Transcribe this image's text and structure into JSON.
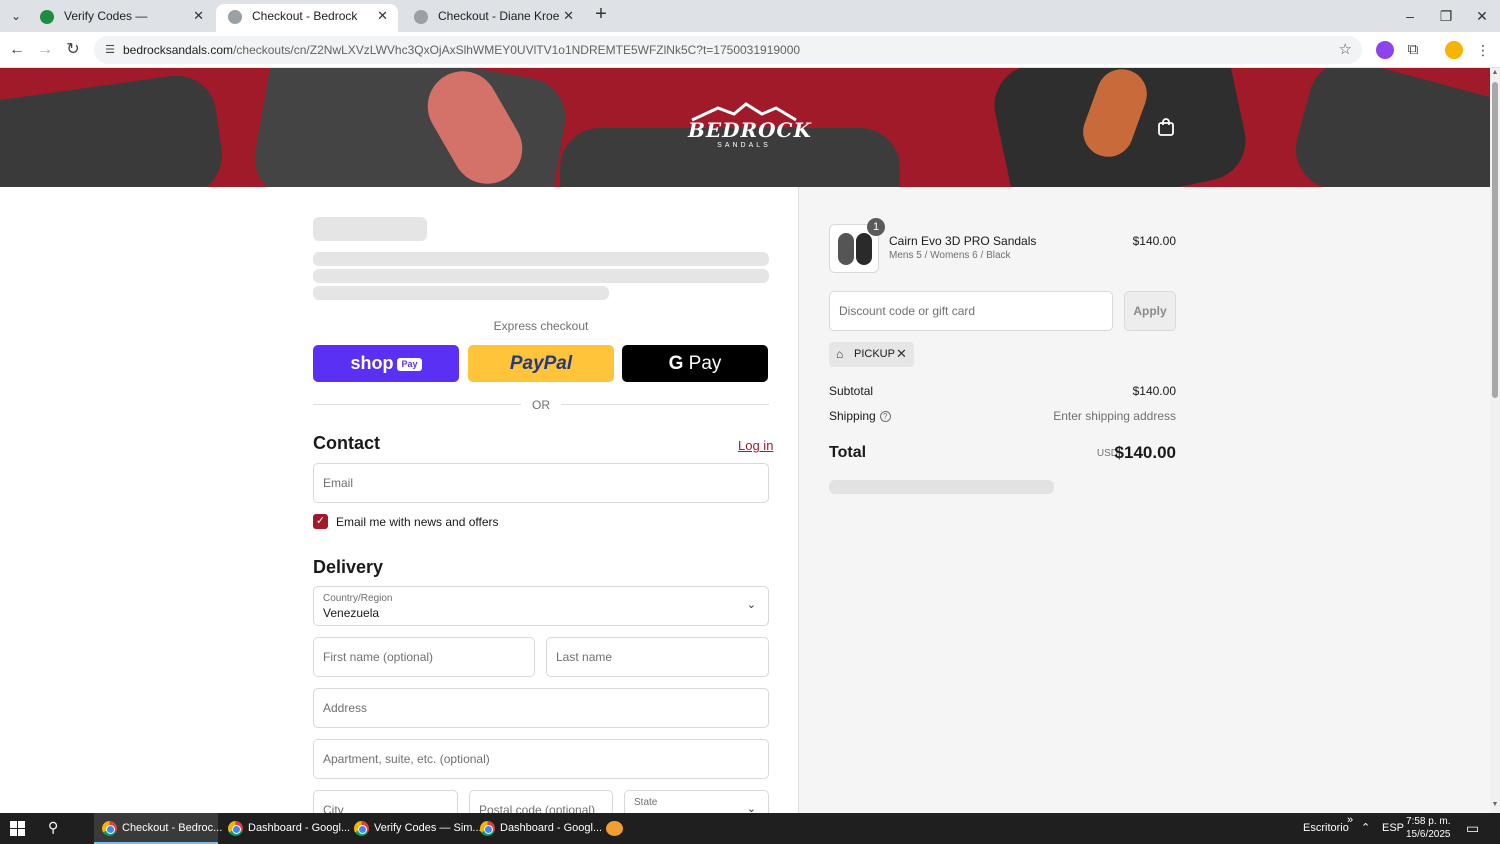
{
  "browser": {
    "tabs": [
      {
        "title": "Verify Codes — SimplyCodes",
        "active": false
      },
      {
        "title": "Checkout - Bedrock Sandals",
        "active": true
      },
      {
        "title": "Checkout - Diane Kroe",
        "active": false
      }
    ],
    "url_host": "bedrocksandals.com",
    "url_path": "/checkouts/cn/Z2NwLXVzLWVhc3QxOjAxSlhWMEY0UVlTV1o1NDREMTE5WFZlNk5C?t=1750031919000"
  },
  "header": {
    "logo_text": "BEDROCK",
    "logo_sub": "SANDALS"
  },
  "checkout": {
    "express_label": "Express checkout",
    "shop_pay_label": "shop",
    "shop_pay_tag": "Pay",
    "paypal_label": "PayPal",
    "gpay_label": "Pay",
    "or_label": "OR",
    "contact_heading": "Contact",
    "login_link": "Log in",
    "email_placeholder": "Email",
    "newsletter_label": "Email me with news and offers",
    "newsletter_checked": true,
    "delivery_heading": "Delivery",
    "country_label": "Country/Region",
    "country_value": "Venezuela",
    "first_name_placeholder": "First name (optional)",
    "last_name_placeholder": "Last name",
    "address_placeholder": "Address",
    "apartment_placeholder": "Apartment, suite, etc. (optional)",
    "city_placeholder": "City",
    "postal_placeholder": "Postal code (optional)",
    "state_label": "State"
  },
  "summary": {
    "item_name": "Cairn Evo 3D PRO Sandals",
    "item_variant": "Mens 5 / Womens 6 / Black",
    "item_price": "$140.00",
    "item_qty": "1",
    "discount_placeholder": "Discount code or gift card",
    "apply_label": "Apply",
    "discount_code": "PICKUP",
    "subtotal_label": "Subtotal",
    "subtotal_value": "$140.00",
    "shipping_label": "Shipping",
    "shipping_value": "Enter shipping address",
    "total_label": "Total",
    "total_currency": "USD",
    "total_value": "$140.00"
  },
  "taskbar": {
    "items": [
      {
        "label": "Checkout - Bedroc...",
        "active": true
      },
      {
        "label": "Dashboard - Googl...",
        "active": false
      },
      {
        "label": "Verify Codes — Sim...",
        "active": false
      },
      {
        "label": "Dashboard - Googl...",
        "active": false
      }
    ],
    "desktop_label": "Escritorio",
    "language": "ESP",
    "time": "7:58 p. m.",
    "date": "15/6/2025"
  },
  "colors": {
    "accent": "#a11a2a",
    "shop_pay": "#5a31f4",
    "paypal": "#ffc439",
    "gpay": "#000000"
  }
}
